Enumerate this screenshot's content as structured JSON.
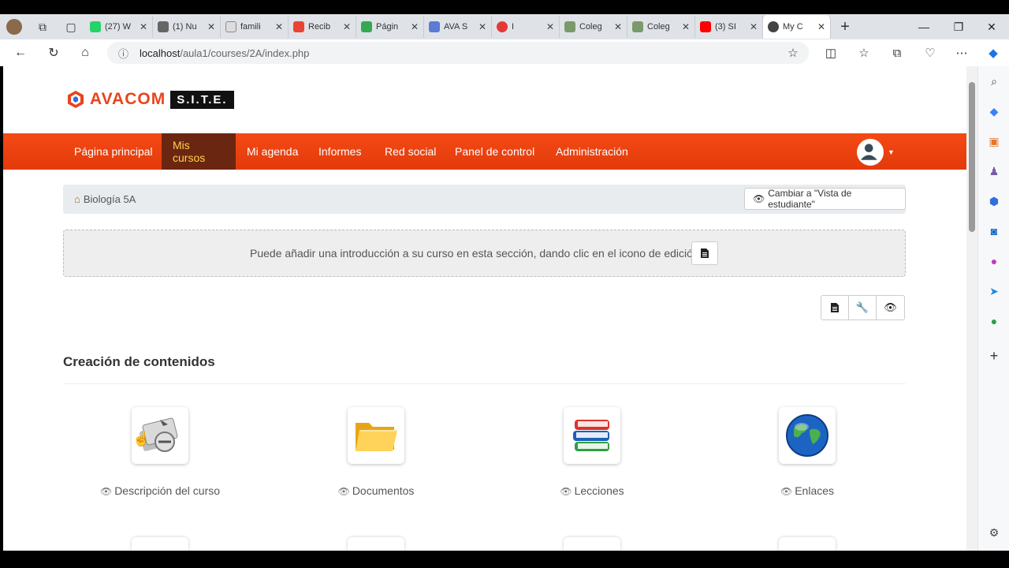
{
  "browser": {
    "tabs": [
      {
        "title": "(27) W",
        "color": "#25d366"
      },
      {
        "title": "(1) Nu",
        "color": "#666666"
      },
      {
        "title": "famili",
        "color": "#888888"
      },
      {
        "title": "Recib",
        "color": "#ea4335"
      },
      {
        "title": "Págin",
        "color": "#34a853"
      },
      {
        "title": "AVA S",
        "color": "#5b7bd5"
      },
      {
        "title": "I",
        "color": "#e53935"
      },
      {
        "title": "Coleg",
        "color": "#7a9a6a"
      },
      {
        "title": "Coleg",
        "color": "#7a9a6a"
      },
      {
        "title": "(3) SI",
        "color": "#ff0000"
      },
      {
        "title": "My C",
        "color": "#444444"
      }
    ],
    "url_host": "localhost",
    "url_path": "/aula1/courses/2A/index.php"
  },
  "site": {
    "brand": "AVACOM",
    "brand_tag": "S.I.T.E."
  },
  "nav": {
    "items": [
      "Página principal",
      "Mis cursos",
      "Mi agenda",
      "Informes",
      "Red social",
      "Panel de control",
      "Administración"
    ],
    "active": "Mis cursos"
  },
  "breadcrumb": {
    "course": "Biología 5A",
    "student_view_button": "Cambiar a \"Vista de estudiante\""
  },
  "intro": {
    "text": "Puede añadir una introducción a su curso en esta sección, dando clic en el icono de edición"
  },
  "section": {
    "title": "Creación de contenidos"
  },
  "tools": [
    {
      "label": "Descripción del curso",
      "icon": "course-description-icon"
    },
    {
      "label": "Documentos",
      "icon": "folder-icon"
    },
    {
      "label": "Lecciones",
      "icon": "books-icon"
    },
    {
      "label": "Enlaces",
      "icon": "globe-icon"
    }
  ],
  "colors": {
    "navbar": "#f34a15",
    "nav_active_bg": "#6b2611",
    "nav_active_text": "#ffd24a"
  }
}
